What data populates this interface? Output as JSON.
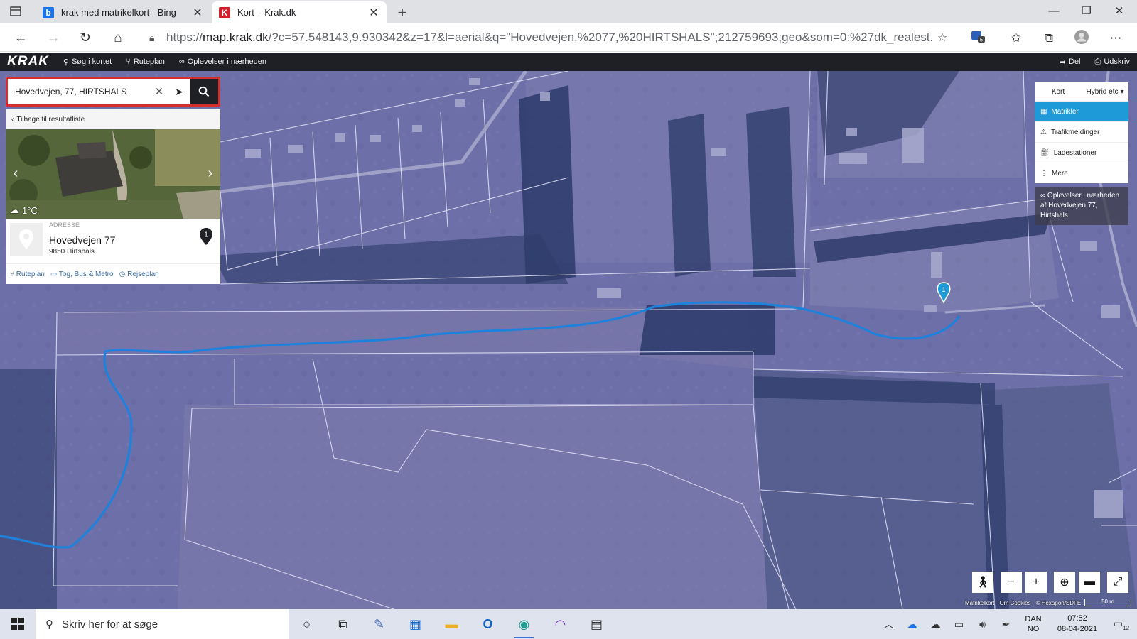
{
  "browser": {
    "tabs": [
      {
        "title": "krak med matrikelkort - Bing",
        "active": false
      },
      {
        "title": "Kort – Krak.dk",
        "active": true
      }
    ],
    "url_prefix": "https://",
    "url_host": "map.krak.dk",
    "url_rest": "/?c=57.548143,9.930342&z=17&l=aerial&q=\"Hovedvejen,%2077,%20HIRTSHALS\";212759693;geo&som=0:%27dk_realest...",
    "extension_badge": "5"
  },
  "krak": {
    "logo": "KRAK",
    "nav": {
      "search_map": "Søg i kortet",
      "route": "Ruteplan",
      "nearby": "Oplevelser i nærheden"
    },
    "share": "Del",
    "print": "Udskriv"
  },
  "panel": {
    "search_value": "Hovedvejen, 77, HIRTSHALS",
    "back_link": "Tilbage til resultatliste",
    "weather": "1°C",
    "address_label": "ADRESSE",
    "address_name": "Hovedvejen 77",
    "address_city": "9850 Hirtshals",
    "badge": "1",
    "links": {
      "route": "Ruteplan",
      "transit": "Tog, Bus & Metro",
      "travel": "Rejseplan"
    }
  },
  "layers": {
    "tab_map": "Kort",
    "tab_hybrid": "Hybrid etc",
    "items": [
      {
        "label": "Matrikler",
        "icon": "parcel-icon",
        "active": true
      },
      {
        "label": "Trafikmeldinger",
        "icon": "warning-icon",
        "active": false
      },
      {
        "label": "Ladestationer",
        "icon": "charger-icon",
        "active": false
      },
      {
        "label": "Mere",
        "icon": "more-icon",
        "active": false
      }
    ],
    "nearby_text": "Oplevelser i nærheden af Hovedvejen 77, Hirtshals"
  },
  "map": {
    "pin_label": "1",
    "attribution": "Matrikelkort · Om Cookies · © Hexagon/SDFE",
    "scale": "50 m",
    "colors": {
      "water": "#1e82dc",
      "overlay": "#6a6ca8",
      "pin": "#1e9ad8"
    }
  },
  "taskbar": {
    "search_placeholder": "Skriv her for at søge",
    "lang_top": "DAN",
    "lang_bottom": "NO",
    "time": "07:52",
    "date": "08-04-2021",
    "notification_count": "12"
  }
}
